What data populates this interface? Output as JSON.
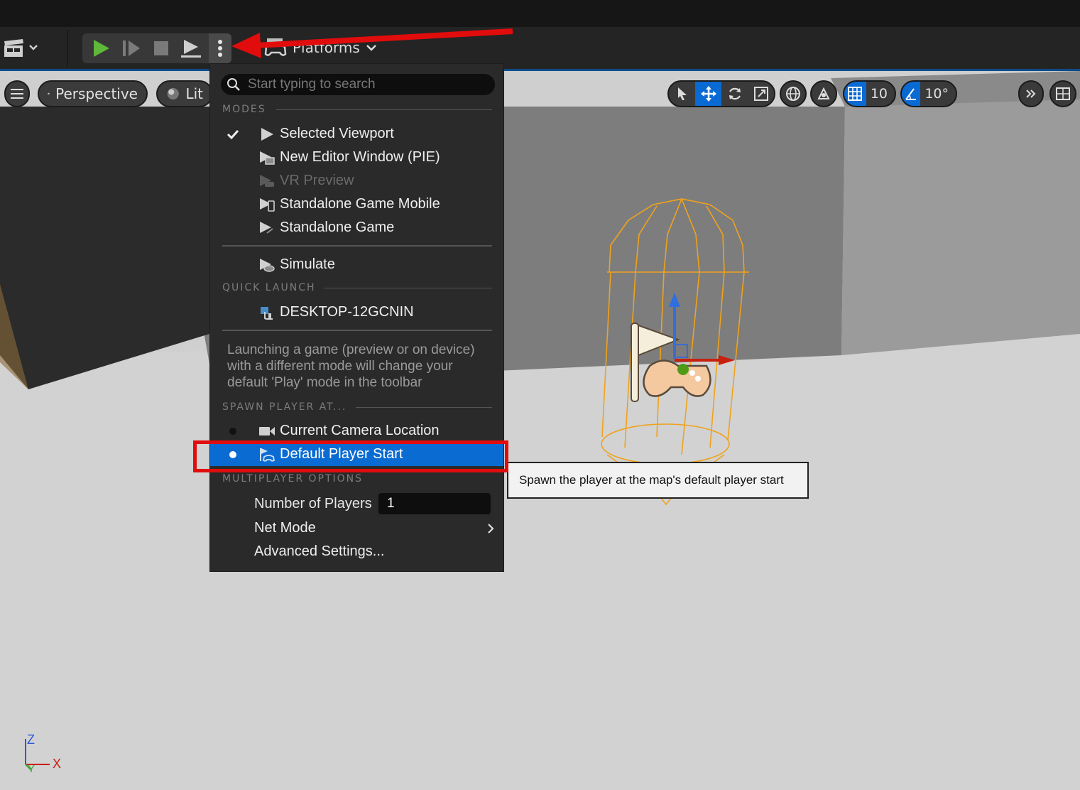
{
  "toolbar": {
    "platforms_label": "Platforms",
    "play_button_icon": "play-icon",
    "frame_advance_icon": "frame-skip-icon",
    "stop_icon": "stop-icon",
    "eject_icon": "eject-icon",
    "more_options_icon": "kebab-menu-icon"
  },
  "viewport": {
    "perspective_label": "Perspective",
    "lit_label": "Lit",
    "grid_snap_value": "10",
    "rotation_snap_value": "10°"
  },
  "menu": {
    "search_placeholder": "Start typing to search",
    "sections": {
      "modes": "MODES",
      "quick_launch": "QUICK LAUNCH",
      "spawn": "SPAWN PLAYER AT...",
      "multiplayer": "MULTIPLAYER OPTIONS"
    },
    "modes": [
      {
        "label": "Selected Viewport",
        "checked": true,
        "disabled": false
      },
      {
        "label": "New Editor Window (PIE)",
        "checked": false,
        "disabled": false
      },
      {
        "label": "VR Preview",
        "checked": false,
        "disabled": true
      },
      {
        "label": "Standalone Game Mobile",
        "checked": false,
        "disabled": false
      },
      {
        "label": "Standalone Game",
        "checked": false,
        "disabled": false
      }
    ],
    "simulate_label": "Simulate",
    "quick_launch_device": "DESKTOP-12GCNIN",
    "note": "Launching a game (preview or on device) with a different mode will change your default 'Play' mode in the toolbar",
    "spawn_options": [
      {
        "label": "Current Camera Location",
        "selected": false
      },
      {
        "label": "Default Player Start",
        "selected": true
      }
    ],
    "number_of_players_label": "Number of Players",
    "number_of_players_value": "1",
    "net_mode_label": "Net Mode",
    "advanced_settings_label": "Advanced Settings..."
  },
  "tooltip": {
    "text": "Spawn the player at the map's default player start"
  },
  "axes": {
    "z": "Z",
    "x": "X",
    "y": "Y"
  },
  "colors": {
    "accent": "#0a6bd2",
    "annotation_red": "#e10c0c",
    "play_green": "#5fb83a"
  }
}
